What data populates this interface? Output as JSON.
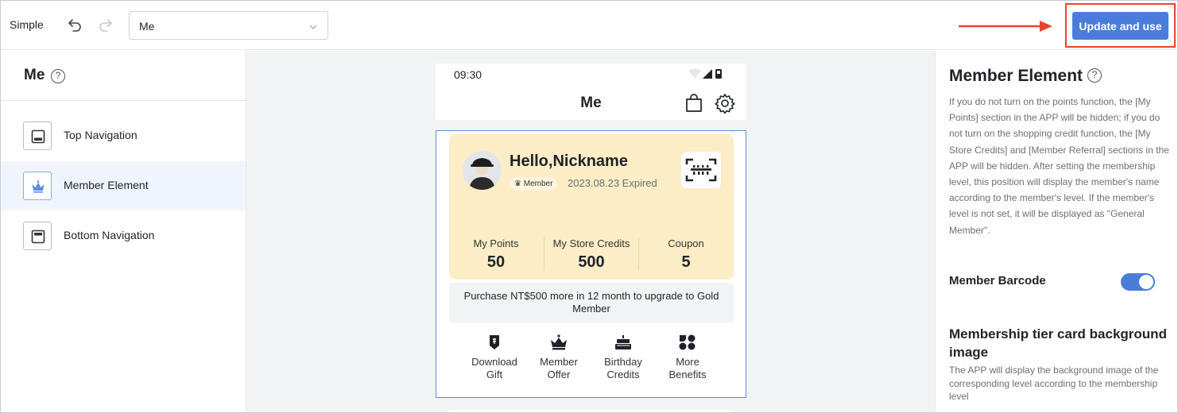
{
  "toolbar": {
    "mode_label": "Simple",
    "page_select": {
      "value": "Me"
    },
    "update_button_label": "Update and use"
  },
  "left_panel": {
    "title": "Me",
    "items": [
      {
        "label": "Top Navigation",
        "icon": "top-navigation-icon"
      },
      {
        "label": "Member Element",
        "icon": "crown-icon",
        "active": true
      },
      {
        "label": "Bottom Navigation",
        "icon": "bottom-navigation-icon"
      }
    ]
  },
  "phone": {
    "status_time": "09:30",
    "app_title": "Me",
    "member": {
      "greeting": "Hello,Nickname",
      "tier": "Member",
      "expiry": "2023.08.23 Expired",
      "stats": [
        {
          "label": "My Points",
          "value": "50"
        },
        {
          "label": "My Store Credits",
          "value": "500"
        },
        {
          "label": "Coupon",
          "value": "5"
        }
      ],
      "upgrade_text": "Purchase NT$500 more in 12 month to upgrade to Gold Member",
      "benefits": [
        {
          "line1": "Download",
          "line2": "Gift",
          "icon": "gift-tag-icon"
        },
        {
          "line1": "Member",
          "line2": "Offer",
          "icon": "crown-icon"
        },
        {
          "line1": "Birthday",
          "line2": "Credits",
          "icon": "cake-icon"
        },
        {
          "line1": "More",
          "line2": "Benefits",
          "icon": "more-grid-icon"
        }
      ]
    }
  },
  "right_panel": {
    "title": "Member Element",
    "description": "If you do not turn on the points function, the [My Points] section in the APP will be hidden; if you do not turn on the shopping credit function, the [My Store Credits] and [Member Referral] sections in the APP will be hidden. After setting the membership level, this position will display the member's name according to the member's level. If the member's level is not set, it will be displayed as \"General Member\".",
    "barcode_label": "Member Barcode",
    "barcode_enabled": true,
    "bg_title": "Membership tier card background image",
    "bg_description": "The APP will display the background image of the corresponding level according to the membership level"
  },
  "colors": {
    "accent": "#4a7ddb",
    "highlight_red": "#e8452c",
    "card_bg": "#fcedc6",
    "active_nav_bg": "#f0f5fd"
  }
}
